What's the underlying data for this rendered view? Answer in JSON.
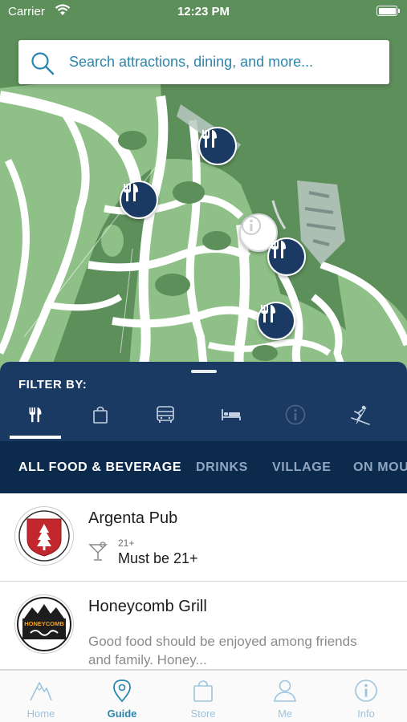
{
  "status_bar": {
    "carrier": "Carrier",
    "time": "12:23 PM"
  },
  "search": {
    "placeholder": "Search attractions, dining, and more..."
  },
  "map": {
    "markers": [
      {
        "type": "dining",
        "icon": "fork-knife-icon"
      },
      {
        "type": "dining",
        "icon": "fork-knife-icon"
      },
      {
        "type": "info",
        "icon": "info-icon"
      },
      {
        "type": "dining",
        "icon": "fork-knife-icon"
      },
      {
        "type": "dining",
        "icon": "fork-knife-icon"
      }
    ]
  },
  "filter": {
    "label": "FILTER BY:",
    "icons": [
      {
        "name": "dining",
        "icon": "fork-knife-icon",
        "selected": true
      },
      {
        "name": "shopping",
        "icon": "shopping-bag-icon",
        "selected": false
      },
      {
        "name": "transport",
        "icon": "bus-icon",
        "selected": false
      },
      {
        "name": "lodging",
        "icon": "bed-icon",
        "selected": false
      },
      {
        "name": "info",
        "icon": "info-icon",
        "selected": false,
        "disabled": true
      },
      {
        "name": "skiing",
        "icon": "skier-icon",
        "selected": false
      }
    ]
  },
  "categories": [
    {
      "label": "ALL FOOD & BEVERAGE",
      "active": true
    },
    {
      "label": "DRINKS",
      "active": false
    },
    {
      "label": "VILLAGE",
      "active": false
    },
    {
      "label": "ON MOUNTAIN",
      "active": false
    }
  ],
  "list": [
    {
      "title": "Argenta Pub",
      "age_small": "21+",
      "age_text": "Must be 21+",
      "logo": "argenta-pub-logo"
    },
    {
      "title": "Honeycomb Grill",
      "description": "Good food should be enjoyed among friends and family. Honey...",
      "logo": "honeycomb-grill-logo",
      "logo_text": "HONEYCOMB"
    }
  ],
  "tabbar": [
    {
      "label": "Home",
      "icon": "mountain-icon",
      "active": false
    },
    {
      "label": "Guide",
      "icon": "map-pin-icon",
      "active": true
    },
    {
      "label": "Store",
      "icon": "shopping-bag-icon",
      "active": false
    },
    {
      "label": "Me",
      "icon": "person-icon",
      "active": false
    },
    {
      "label": "Info",
      "icon": "info-icon",
      "active": false
    }
  ],
  "colors": {
    "primary_navy": "#1b3a63",
    "tab_strip_navy": "#0c2a4c",
    "accent_blue": "#2a86ad",
    "map_forest": "#5d8f5a",
    "map_trail": "#ffffff"
  }
}
